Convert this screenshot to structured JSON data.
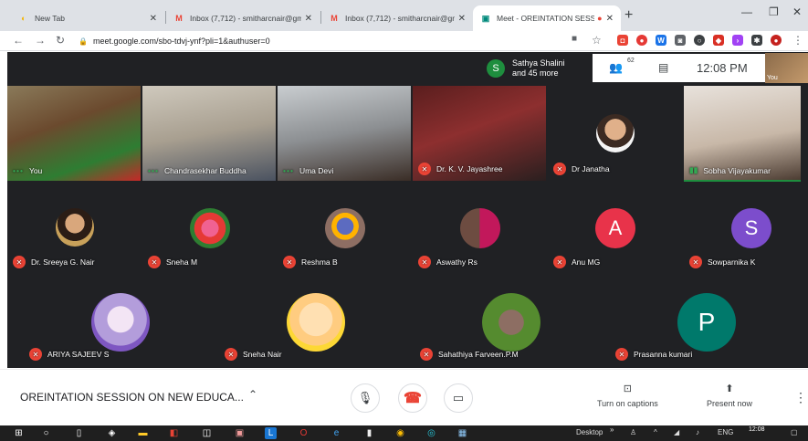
{
  "browser": {
    "tabs": [
      {
        "title": "New Tab"
      },
      {
        "title": "Inbox (7,712) - smitharcnair@gm"
      },
      {
        "title": "Inbox (7,712) - smitharcnair@gm"
      },
      {
        "title": "Meet - OREINTATION SESSIO"
      }
    ],
    "url": "meet.google.com/sbo-tdvj-ynf?pli=1&authuser=0"
  },
  "meet": {
    "joined_avatar": "S",
    "joined_name": "Sathya Shalini",
    "joined_more": "and 45 more",
    "participant_count": "62",
    "time": "12:08 PM",
    "self_label": "You",
    "meeting_title": "OREINTATION SESSION ON NEW EDUCA...",
    "captions_label": "Turn on captions",
    "present_label": "Present now",
    "participants": [
      {
        "name": "You"
      },
      {
        "name": "Chandrasekhar Buddha"
      },
      {
        "name": "Uma Devi"
      },
      {
        "name": "Dr. K. V. Jayashree"
      },
      {
        "name": "Dr Janatha"
      },
      {
        "name": "Sobha Vijayakumar"
      },
      {
        "name": "Dr. Sreeya G. Nair"
      },
      {
        "name": "Sneha M"
      },
      {
        "name": "Reshma B"
      },
      {
        "name": "Aswathy Rs"
      },
      {
        "name": "Anu MG",
        "initial": "A",
        "color": "#e8334a"
      },
      {
        "name": "Sowparnika K",
        "initial": "S",
        "color": "#7c4dcc"
      },
      {
        "name": "ARIYA SAJEEV S"
      },
      {
        "name": "Sneha Nair"
      },
      {
        "name": "Sahathiya Farveen.P.M"
      },
      {
        "name": "Prasanna kumari",
        "initial": "P",
        "color": "#00796b"
      }
    ]
  },
  "taskbar": {
    "desktop_label": "Desktop",
    "lang": "ENG",
    "time": "12:08"
  }
}
